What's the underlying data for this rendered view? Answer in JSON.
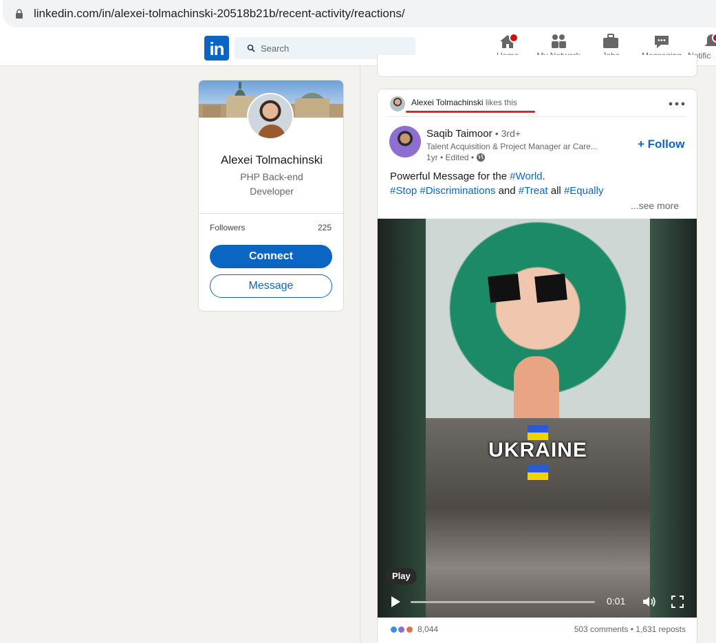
{
  "browser": {
    "url": "linkedin.com/in/alexei-tolmachinski-20518b21b/recent-activity/reactions/"
  },
  "nav": {
    "logo": "in",
    "search_placeholder": "Search",
    "items": [
      {
        "label": "Home",
        "icon": "home-icon"
      },
      {
        "label": "My Network",
        "icon": "network-icon"
      },
      {
        "label": "Jobs",
        "icon": "briefcase-icon"
      },
      {
        "label": "Messaging",
        "icon": "messaging-icon"
      },
      {
        "label": "Notific",
        "icon": "bell-icon"
      }
    ]
  },
  "profile": {
    "name": "Alexei Tolmachinski",
    "headline": "PHP Back-end Developer",
    "followers_label": "Followers",
    "followers_count": "225",
    "connect_label": "Connect",
    "message_label": "Message"
  },
  "post": {
    "activity_actor": "Alexei Tolmachinski",
    "activity_verb": "likes this",
    "author_name": "Saqib Taimoor",
    "author_degree": "• 3rd+",
    "author_title": "Talent Acquisition & Project Manager ar Care...",
    "author_meta": "1yr • Edited •",
    "follow_label": "+ Follow",
    "text_line1_prefix": "Powerful Message for the ",
    "text_line1_tag": "#World",
    "text_line1_suffix": ".",
    "text_line2": [
      {
        "text": "#Stop",
        "tag": true
      },
      {
        "text": " ",
        "tag": false
      },
      {
        "text": "#Discriminations",
        "tag": true
      },
      {
        "text": " and ",
        "tag": false
      },
      {
        "text": "#Treat",
        "tag": true
      },
      {
        "text": " all ",
        "tag": false
      },
      {
        "text": "#Equally",
        "tag": true
      }
    ],
    "see_more": "...see more",
    "video": {
      "overlay_text": "UKRAINE",
      "play_label": "Play",
      "time": "0:01",
      "progress": 0.0
    },
    "reactions_count": "8,044",
    "comments": "503 comments",
    "reposts": "1,631 reposts",
    "stats_separator": " • "
  },
  "colors": {
    "brand": "#0a66c2",
    "badge": "#cc1016",
    "highlight_underline": "#e0202a"
  }
}
